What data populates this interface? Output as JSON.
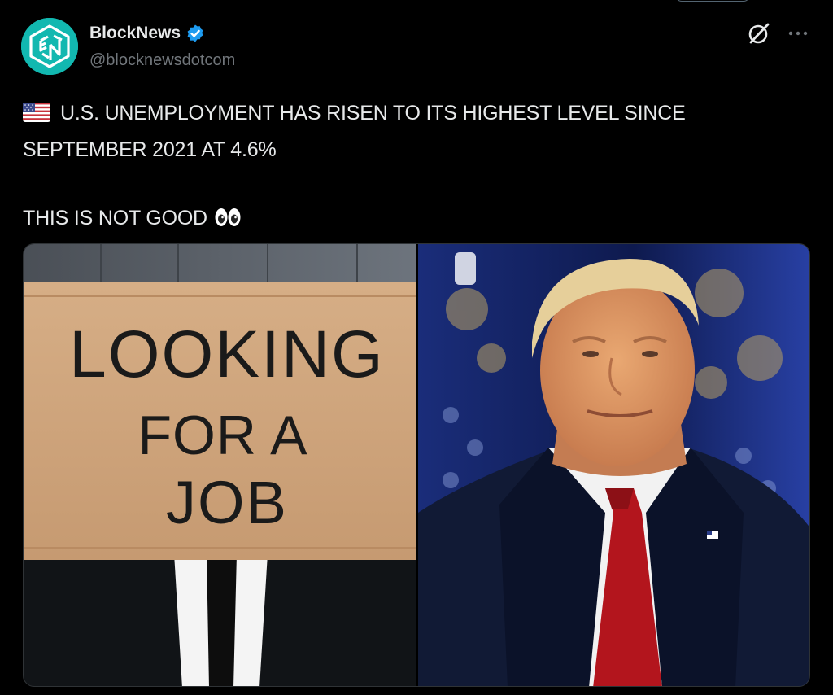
{
  "post": {
    "author": {
      "display_name": "BlockNews",
      "handle": "@blocknewsdotcom",
      "verified": true,
      "avatar_icon": "blocknews-logo-icon",
      "avatar_color": "#12b8b0"
    },
    "actions": {
      "grok_icon": "grok-icon",
      "more_icon": "more-icon"
    },
    "text_line1": "U.S. UNEMPLOYMENT HAS RISEN TO ITS HIGHEST LEVEL SINCE",
    "text_line2": "SEPTEMBER 2021 AT 4.6%",
    "text_line3": "THIS IS NOT GOOD",
    "emoji_flag": "us-flag-icon",
    "emoji_eyes": "eyes-icon",
    "media": {
      "left_image": {
        "name": "looking-for-job-sign-photo",
        "sign_line1": "LOOKING",
        "sign_line2": "FOR A",
        "sign_line3": "JOB"
      },
      "right_image": {
        "name": "trump-portrait-photo"
      }
    }
  },
  "colors": {
    "background": "#000000",
    "text": "#e7e9ea",
    "secondary_text": "#71767b",
    "verified_blue": "#1d9bf0"
  }
}
